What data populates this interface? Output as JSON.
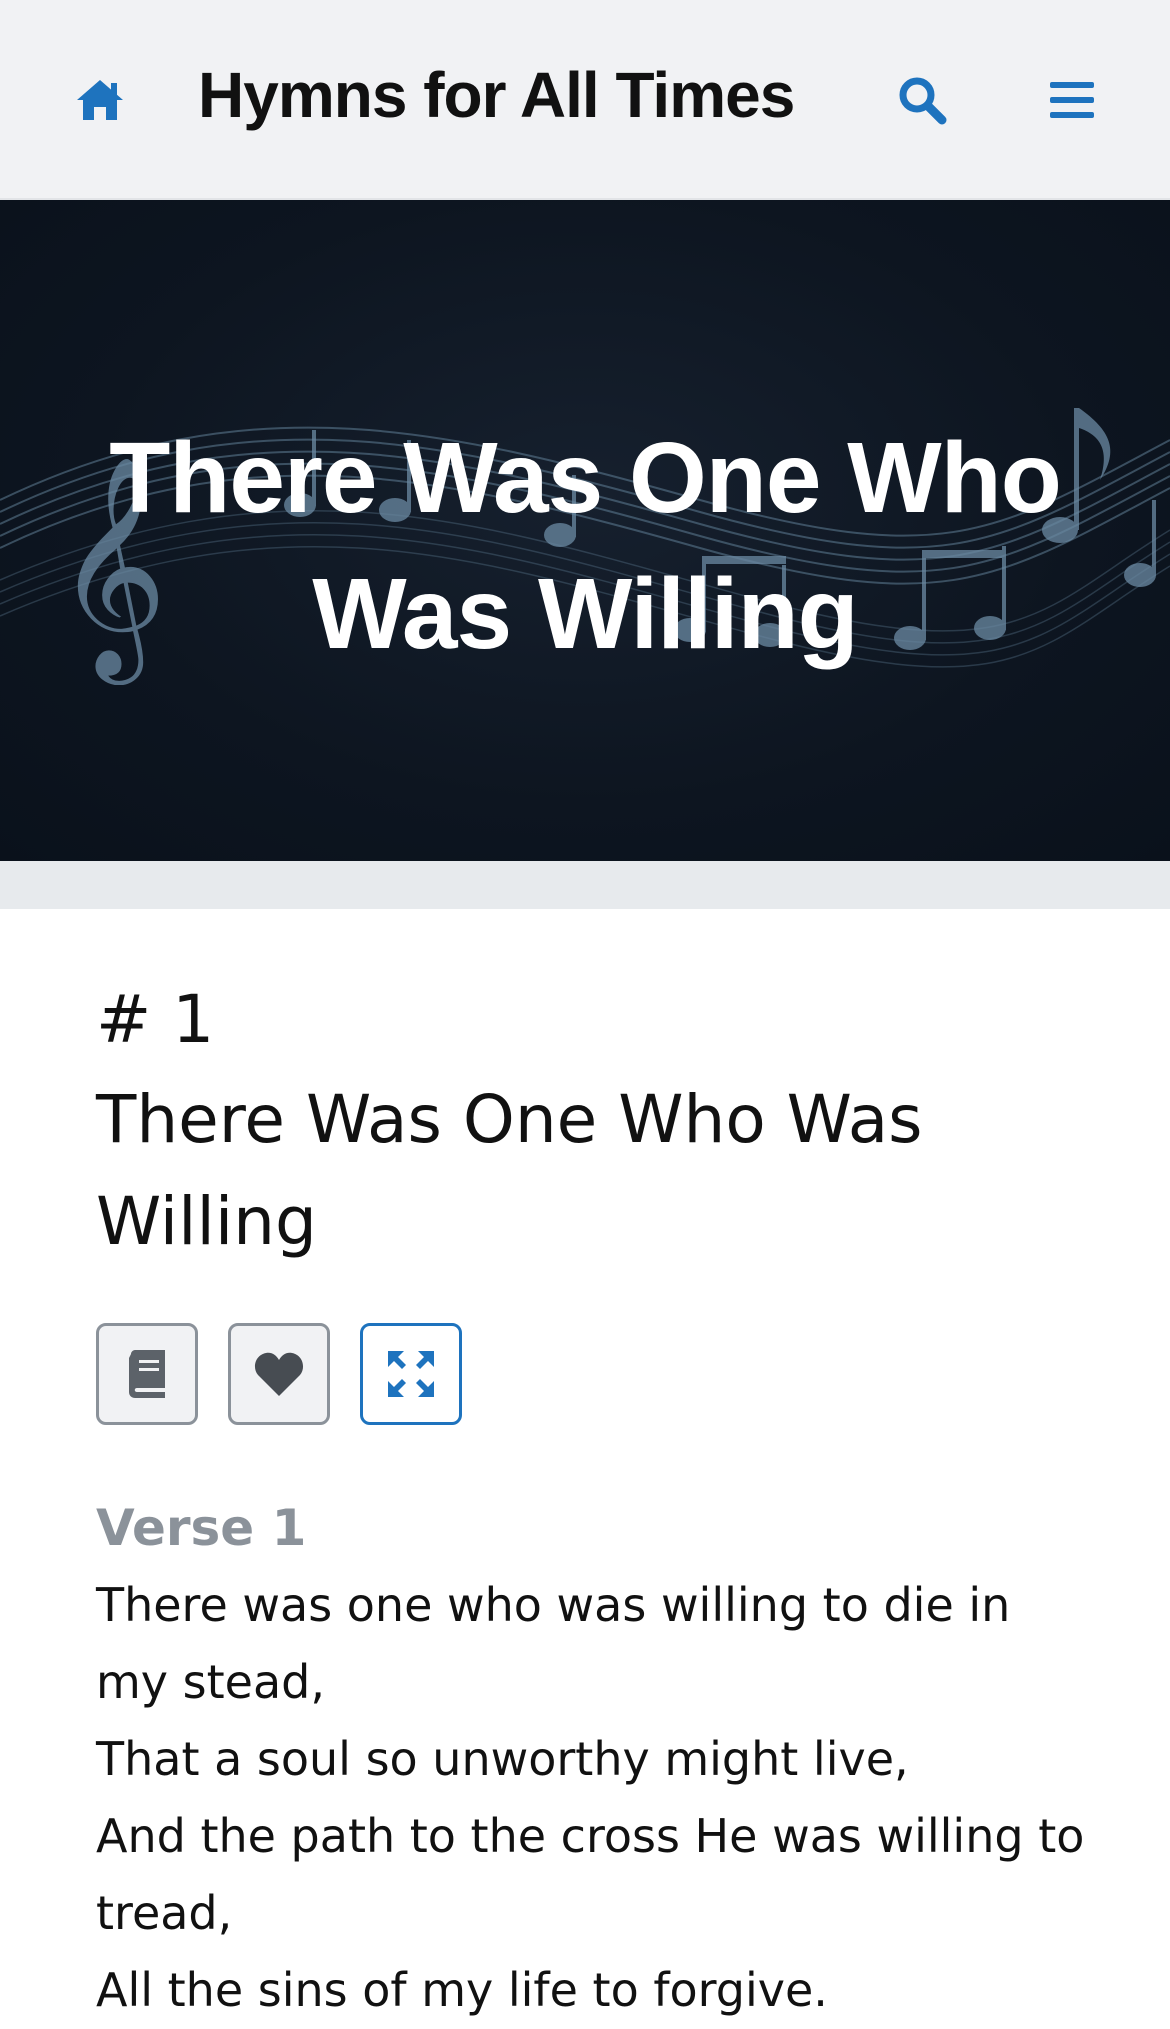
{
  "header": {
    "home_icon": "home-icon",
    "title": "Hymns for All Times",
    "search_icon": "search-icon",
    "menu_icon": "menu-icon",
    "accent_color": "#1e73be"
  },
  "hero": {
    "title": "There Was One Who Was Willing"
  },
  "hymn": {
    "number": "# 1",
    "title": "There Was One Who Was Willing",
    "actions": [
      {
        "icon": "book-icon"
      },
      {
        "icon": "heart-icon"
      },
      {
        "icon": "expand-icon"
      }
    ],
    "verses": [
      {
        "label": "Verse 1",
        "lines": [
          "There was one who was willing to die in my stead,",
          "That a soul so unworthy might live,",
          "And the path to the cross He was willing to tread,",
          "All the sins of my life to forgive."
        ]
      }
    ]
  }
}
